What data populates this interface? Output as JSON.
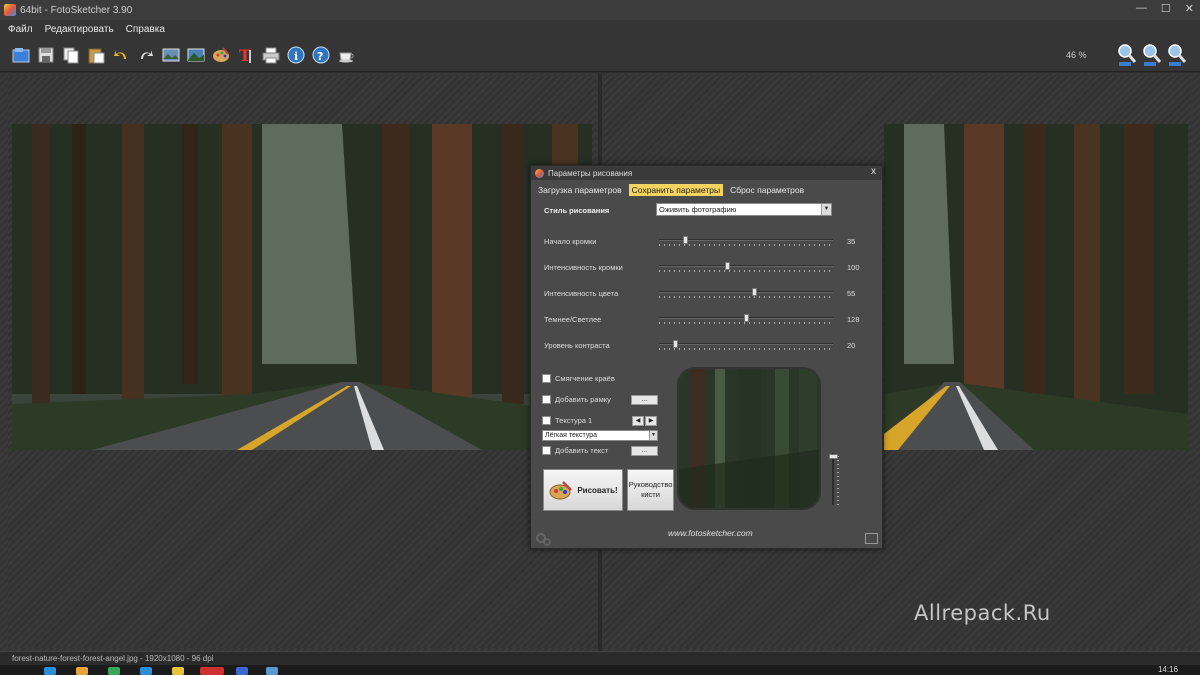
{
  "window": {
    "title": "64bit - FotoSketcher 3.90"
  },
  "menu": {
    "items": [
      "Файл",
      "Редактировать",
      "Справка"
    ]
  },
  "toolbar": {
    "icons": [
      "open-icon",
      "save-icon",
      "copy-icon",
      "paste-icon",
      "undo-icon",
      "redo-icon",
      "image-icon",
      "landscape-icon",
      "palette-icon",
      "text-icon",
      "print-icon",
      "info-icon",
      "help-icon",
      "coffee-icon"
    ],
    "zoom_label": "46 %",
    "zoom_icons": [
      "zoom-in-icon",
      "zoom-out-icon",
      "zoom-fit-icon"
    ]
  },
  "watermark": "Allrepack.Ru",
  "status": {
    "file_info": "forest-nature-forest-forest-angel.jpg - 1920x1080 - 96 dpi"
  },
  "clock": "14:16",
  "dialog": {
    "title": "Параметры рисования",
    "close": "x",
    "tabs": [
      "Загрузка параметров",
      "Сохранить параметры",
      "Сброс параметров"
    ],
    "active_tab": "Сохранить параметры",
    "style_label": "Стиль рисования",
    "style_value": "Оживить фотографию",
    "sliders": [
      {
        "label": "Начало кромки",
        "value": "35",
        "level": 0.14
      },
      {
        "label": "Интенсивность кромки",
        "value": "100",
        "level": 0.39
      },
      {
        "label": "Интенсивность цвета",
        "value": "55",
        "level": 0.55
      },
      {
        "label": "Темнее/Светлее",
        "value": "128",
        "level": 0.5
      },
      {
        "label": "Уровень контраста",
        "value": "20",
        "level": 0.08
      }
    ],
    "smooth_edges": "Смягчение краёв",
    "add_frame": "Добавить рамку",
    "texture": "Текстура 1",
    "texture_value": "Лёгкая текстура",
    "add_text": "Добавить текст",
    "dots": "...",
    "draw_button": "Рисовать!",
    "guide_button": "Руководство кисти",
    "website": "www.fotosketcher.com"
  }
}
